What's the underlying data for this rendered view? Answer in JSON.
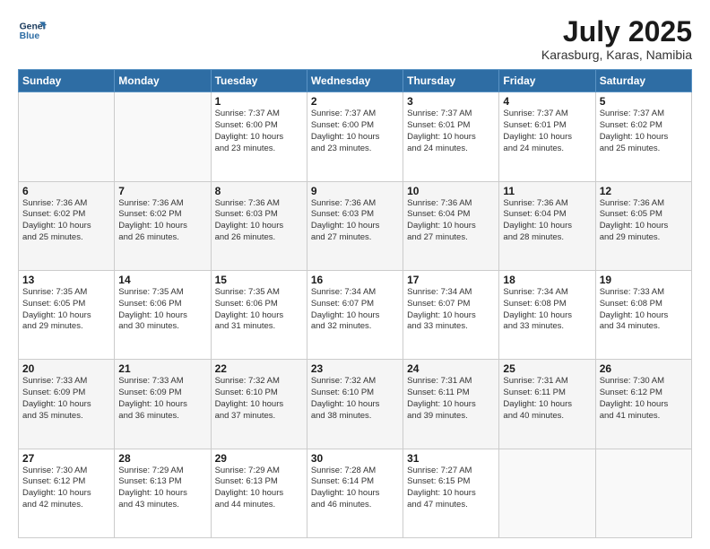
{
  "logo": {
    "line1": "General",
    "line2": "Blue"
  },
  "title": "July 2025",
  "location": "Karasburg, Karas, Namibia",
  "weekdays": [
    "Sunday",
    "Monday",
    "Tuesday",
    "Wednesday",
    "Thursday",
    "Friday",
    "Saturday"
  ],
  "weeks": [
    [
      {
        "day": "",
        "info": ""
      },
      {
        "day": "",
        "info": ""
      },
      {
        "day": "1",
        "info": "Sunrise: 7:37 AM\nSunset: 6:00 PM\nDaylight: 10 hours\nand 23 minutes."
      },
      {
        "day": "2",
        "info": "Sunrise: 7:37 AM\nSunset: 6:00 PM\nDaylight: 10 hours\nand 23 minutes."
      },
      {
        "day": "3",
        "info": "Sunrise: 7:37 AM\nSunset: 6:01 PM\nDaylight: 10 hours\nand 24 minutes."
      },
      {
        "day": "4",
        "info": "Sunrise: 7:37 AM\nSunset: 6:01 PM\nDaylight: 10 hours\nand 24 minutes."
      },
      {
        "day": "5",
        "info": "Sunrise: 7:37 AM\nSunset: 6:02 PM\nDaylight: 10 hours\nand 25 minutes."
      }
    ],
    [
      {
        "day": "6",
        "info": "Sunrise: 7:36 AM\nSunset: 6:02 PM\nDaylight: 10 hours\nand 25 minutes."
      },
      {
        "day": "7",
        "info": "Sunrise: 7:36 AM\nSunset: 6:02 PM\nDaylight: 10 hours\nand 26 minutes."
      },
      {
        "day": "8",
        "info": "Sunrise: 7:36 AM\nSunset: 6:03 PM\nDaylight: 10 hours\nand 26 minutes."
      },
      {
        "day": "9",
        "info": "Sunrise: 7:36 AM\nSunset: 6:03 PM\nDaylight: 10 hours\nand 27 minutes."
      },
      {
        "day": "10",
        "info": "Sunrise: 7:36 AM\nSunset: 6:04 PM\nDaylight: 10 hours\nand 27 minutes."
      },
      {
        "day": "11",
        "info": "Sunrise: 7:36 AM\nSunset: 6:04 PM\nDaylight: 10 hours\nand 28 minutes."
      },
      {
        "day": "12",
        "info": "Sunrise: 7:36 AM\nSunset: 6:05 PM\nDaylight: 10 hours\nand 29 minutes."
      }
    ],
    [
      {
        "day": "13",
        "info": "Sunrise: 7:35 AM\nSunset: 6:05 PM\nDaylight: 10 hours\nand 29 minutes."
      },
      {
        "day": "14",
        "info": "Sunrise: 7:35 AM\nSunset: 6:06 PM\nDaylight: 10 hours\nand 30 minutes."
      },
      {
        "day": "15",
        "info": "Sunrise: 7:35 AM\nSunset: 6:06 PM\nDaylight: 10 hours\nand 31 minutes."
      },
      {
        "day": "16",
        "info": "Sunrise: 7:34 AM\nSunset: 6:07 PM\nDaylight: 10 hours\nand 32 minutes."
      },
      {
        "day": "17",
        "info": "Sunrise: 7:34 AM\nSunset: 6:07 PM\nDaylight: 10 hours\nand 33 minutes."
      },
      {
        "day": "18",
        "info": "Sunrise: 7:34 AM\nSunset: 6:08 PM\nDaylight: 10 hours\nand 33 minutes."
      },
      {
        "day": "19",
        "info": "Sunrise: 7:33 AM\nSunset: 6:08 PM\nDaylight: 10 hours\nand 34 minutes."
      }
    ],
    [
      {
        "day": "20",
        "info": "Sunrise: 7:33 AM\nSunset: 6:09 PM\nDaylight: 10 hours\nand 35 minutes."
      },
      {
        "day": "21",
        "info": "Sunrise: 7:33 AM\nSunset: 6:09 PM\nDaylight: 10 hours\nand 36 minutes."
      },
      {
        "day": "22",
        "info": "Sunrise: 7:32 AM\nSunset: 6:10 PM\nDaylight: 10 hours\nand 37 minutes."
      },
      {
        "day": "23",
        "info": "Sunrise: 7:32 AM\nSunset: 6:10 PM\nDaylight: 10 hours\nand 38 minutes."
      },
      {
        "day": "24",
        "info": "Sunrise: 7:31 AM\nSunset: 6:11 PM\nDaylight: 10 hours\nand 39 minutes."
      },
      {
        "day": "25",
        "info": "Sunrise: 7:31 AM\nSunset: 6:11 PM\nDaylight: 10 hours\nand 40 minutes."
      },
      {
        "day": "26",
        "info": "Sunrise: 7:30 AM\nSunset: 6:12 PM\nDaylight: 10 hours\nand 41 minutes."
      }
    ],
    [
      {
        "day": "27",
        "info": "Sunrise: 7:30 AM\nSunset: 6:12 PM\nDaylight: 10 hours\nand 42 minutes."
      },
      {
        "day": "28",
        "info": "Sunrise: 7:29 AM\nSunset: 6:13 PM\nDaylight: 10 hours\nand 43 minutes."
      },
      {
        "day": "29",
        "info": "Sunrise: 7:29 AM\nSunset: 6:13 PM\nDaylight: 10 hours\nand 44 minutes."
      },
      {
        "day": "30",
        "info": "Sunrise: 7:28 AM\nSunset: 6:14 PM\nDaylight: 10 hours\nand 46 minutes."
      },
      {
        "day": "31",
        "info": "Sunrise: 7:27 AM\nSunset: 6:15 PM\nDaylight: 10 hours\nand 47 minutes."
      },
      {
        "day": "",
        "info": ""
      },
      {
        "day": "",
        "info": ""
      }
    ]
  ]
}
